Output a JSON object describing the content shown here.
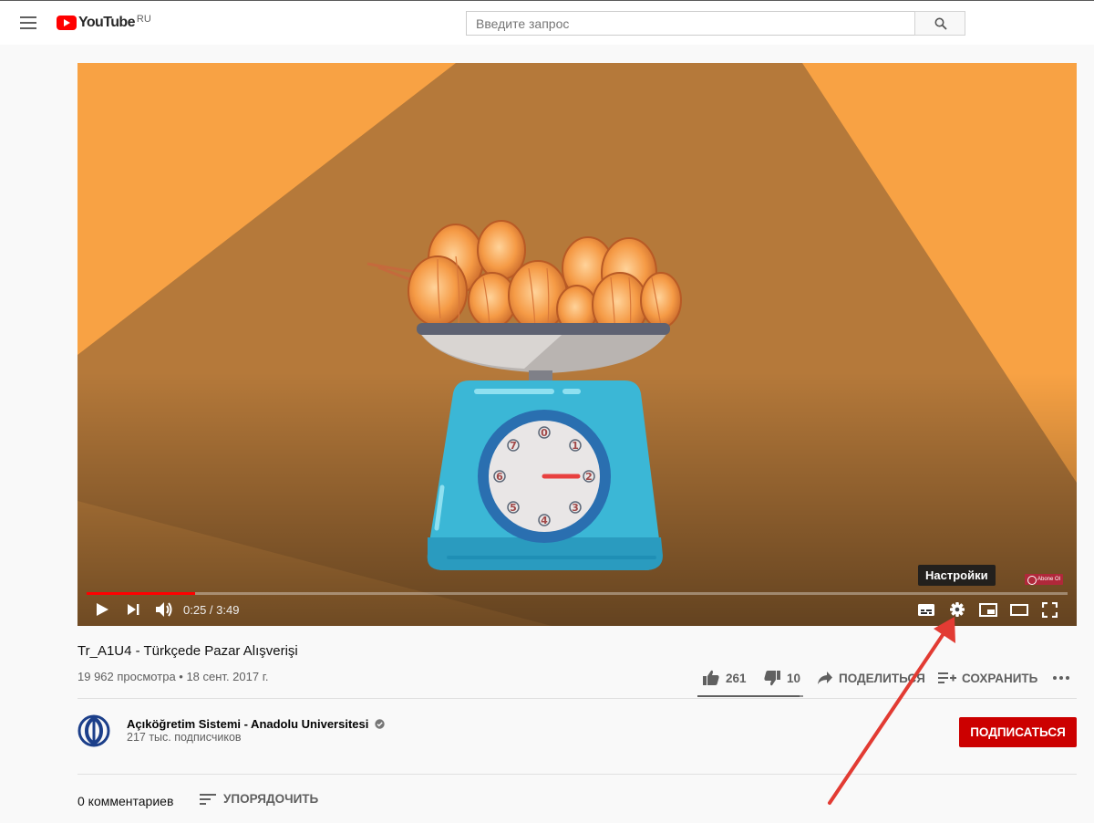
{
  "masthead": {
    "logo_text": "YouTube",
    "country_code": "RU",
    "search_placeholder": "Введите запрос"
  },
  "player": {
    "time_current": "0:25",
    "time_separator": " / ",
    "time_total": "3:49",
    "progress_fraction": 0.111,
    "tooltip": "Настройки",
    "brand_badge": "Abone Ol"
  },
  "video": {
    "title": "Tr_A1U4 - Türkçede Pazar Alışverişi",
    "views": "19 962 просмотра",
    "separator": " • ",
    "date": "18 сент. 2017 г."
  },
  "actions": {
    "likes": "261",
    "dislikes": "10",
    "share_label": "ПОДЕЛИТЬСЯ",
    "save_label": "СОХРАНИТЬ",
    "like_ratio": 0.963
  },
  "channel": {
    "name": "Açıköğretim Sistemi - Anadolu Universitesi",
    "subscribers": "217 тыс. подписчиков",
    "subscribe_label": "ПОДПИСАТЬСЯ"
  },
  "comments": {
    "count_label": "0 комментариев",
    "sort_label": "УПОРЯДОЧИТЬ"
  },
  "scale_dial_numbers": [
    "0",
    "1",
    "2",
    "3",
    "4",
    "5",
    "6",
    "7"
  ],
  "colors": {
    "brand_red": "#ff0000",
    "subscribe_red": "#cc0000",
    "video_bg_dark": "#b5793a",
    "video_bg_light": "#f8a244",
    "scale_blue": "#3bb7d6",
    "annotation_arrow": "#e23b33"
  }
}
